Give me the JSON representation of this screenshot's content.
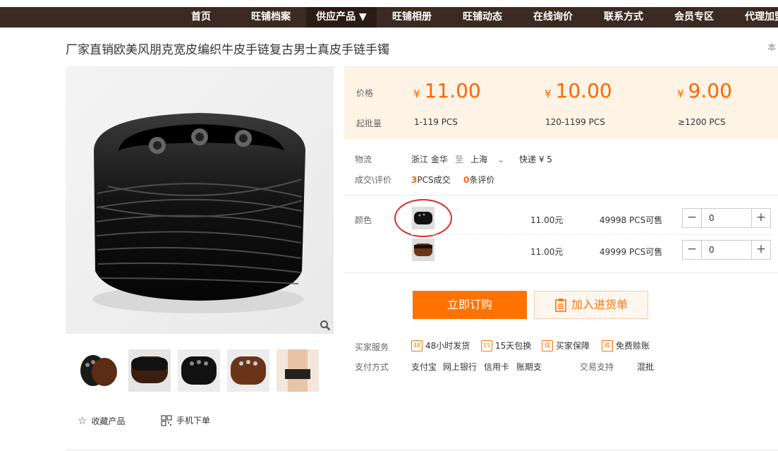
{
  "nav": {
    "items": [
      "首页",
      "旺铺档案",
      "供应产品 ▼",
      "旺铺相册",
      "旺铺动态",
      "在线询价",
      "联系方式",
      "会员专区",
      "代理加盟"
    ]
  },
  "product": {
    "title": "厂家直销欧美风朋克宽皮编织牛皮手链复古男士真皮手链手镯",
    "title_right": "本"
  },
  "price": {
    "price_label": "价格",
    "moq_label": "起批量",
    "currency": "¥",
    "tiers": [
      {
        "price": "11.00",
        "moq": "1-119  PCS"
      },
      {
        "price": "10.00",
        "moq": "120-1199  PCS"
      },
      {
        "price": "9.00",
        "moq": "≥1200  PCS"
      }
    ]
  },
  "logistics": {
    "label": "物流",
    "from": "浙江 金华",
    "to_word": "至",
    "to": "上海",
    "express": "快递 ¥ 5"
  },
  "deals": {
    "label": "成交\\评价",
    "count": "3",
    "count_suffix": "PCS成交",
    "reviews": "0",
    "reviews_suffix": "条评价"
  },
  "sku": {
    "label": "颜色",
    "rows": [
      {
        "price": "11.00元",
        "stock": "49998 PCS可售",
        "qty": "0"
      },
      {
        "price": "11.00元",
        "stock": "49999 PCS可售",
        "qty": "0"
      }
    ]
  },
  "actions": {
    "buy": "立即订购",
    "cart": "加入进货单"
  },
  "service": {
    "label": "买家服务",
    "items": [
      "48小时发货",
      "15天包换",
      "买家保障",
      "免费赊账"
    ],
    "icons": [
      "48",
      "15",
      "保",
      "赊"
    ]
  },
  "payment": {
    "label": "支付方式",
    "methods": [
      "支付宝",
      "网上银行",
      "信用卡",
      "账期支"
    ],
    "trade_label": "交易支持",
    "trade_value": "混批"
  },
  "extras": {
    "favorite": "收藏产品",
    "mobile": "手机下单"
  },
  "colors": {
    "accent": "#ff7200",
    "nav_bg": "#3a2a22",
    "price_bg": "#fff3e6"
  }
}
